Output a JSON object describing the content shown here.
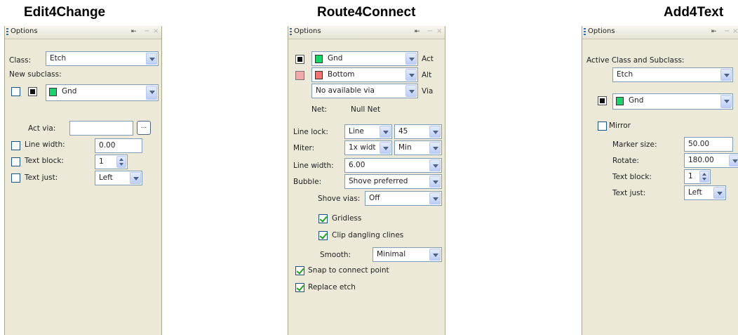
{
  "panels": [
    {
      "title": "Edit4Change",
      "header": "Options",
      "class_label": "Class:",
      "class_value": "Etch",
      "new_subclass_label": "New subclass:",
      "subclass_value": "Gnd",
      "act_via_label": "Act via:",
      "act_via_value": "",
      "browse_label": "...",
      "line_width_label": "Line width:",
      "line_width_value": "0.00",
      "text_block_label": "Text block:",
      "text_block_value": "1",
      "text_just_label": "Text just:",
      "text_just_value": "Left"
    },
    {
      "title": "Route4Connect",
      "header": "Options",
      "act_layer": "Gnd",
      "act_label": "Act",
      "alt_layer": "Bottom",
      "alt_label": "Alt",
      "via_value": "No available via",
      "via_label": "Via",
      "net_label": "Net:",
      "net_value": "Null Net",
      "line_lock_label": "Line lock:",
      "line_lock_value": "Line",
      "line_lock_angle": "45",
      "miter_label": "Miter:",
      "miter_value": "1x widt",
      "miter_min": "Min",
      "line_width_label": "Line width:",
      "line_width_value": "6.00",
      "bubble_label": "Bubble:",
      "bubble_value": "Shove preferred",
      "shove_vias_label": "Shove vias:",
      "shove_vias_value": "Off",
      "gridless_label": "Gridless",
      "clip_label": "Clip dangling clines",
      "smooth_label": "Smooth:",
      "smooth_value": "Minimal",
      "snap_label": "Snap to connect point",
      "replace_label": "Replace etch"
    },
    {
      "title": "Add4Text",
      "header": "Options",
      "active_class_label": "Active Class and Subclass:",
      "class_value": "Etch",
      "subclass_value": "Gnd",
      "mirror_label": "Mirror",
      "marker_size_label": "Marker size:",
      "marker_size_value": "50.00",
      "rotate_label": "Rotate:",
      "rotate_value": "180.00",
      "text_block_label": "Text block:",
      "text_block_value": "1",
      "text_just_label": "Text just:",
      "text_just_value": "Left"
    }
  ],
  "header_controls": {
    "pin": "⇤",
    "minimize": "−",
    "close": "×"
  },
  "checkbox_states": {
    "edit_line_width": false,
    "edit_text_block": false,
    "edit_text_just": false,
    "gridless": true,
    "clip_dangling": true,
    "snap": true,
    "replace_etch": true,
    "mirror": false
  },
  "colors": {
    "panel_bg": "#ece9d8",
    "gnd_chip": "#19d36c",
    "bottom_chip": "#f07575",
    "check": "#21a121"
  }
}
